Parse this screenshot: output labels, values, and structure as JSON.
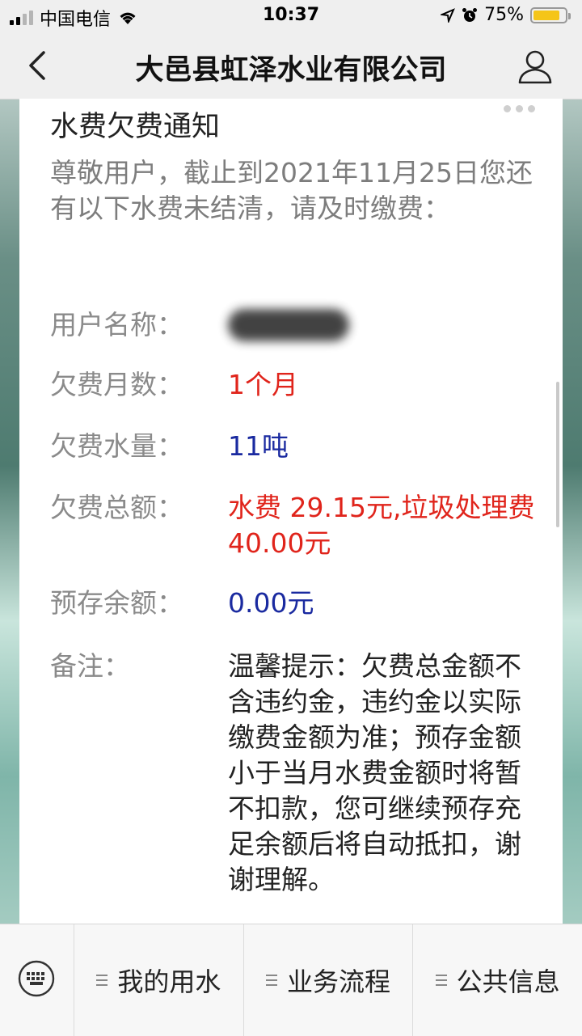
{
  "status": {
    "carrier": "中国电信",
    "time": "10:37",
    "battery": "75%"
  },
  "nav": {
    "title": "大邑县虹泽水业有限公司",
    "icons": [
      "back-icon",
      "user-icon"
    ]
  },
  "notice": {
    "title": "水费欠费通知",
    "intro": "尊敬用户，截止到2021年11月25日您还有以下水费未结清，请及时缴费：",
    "rows": [
      {
        "label": "用户名称：",
        "value": ""
      },
      {
        "label": "欠费月数：",
        "value": "1个月"
      },
      {
        "label": "欠费水量：",
        "value": "11吨"
      },
      {
        "label": "欠费总额：",
        "value": "水费 29.15元,垃圾处理费 40.00元"
      },
      {
        "label": "预存余额：",
        "value": "0.00元"
      },
      {
        "label": "备注：",
        "value": "温馨提示：欠费总金额不含违约金，违约金以实际缴费金额为准；预存金额小于当月水费金额时将暂不扣款，您可继续预存充足余额后将自动抵扣，谢谢理解。"
      }
    ],
    "colors": {
      "red": "#e0241b",
      "blue": "#1a2aa0"
    }
  },
  "menu": {
    "items": [
      {
        "label": "我的用水"
      },
      {
        "label": "业务流程"
      },
      {
        "label": "公共信息"
      }
    ]
  }
}
